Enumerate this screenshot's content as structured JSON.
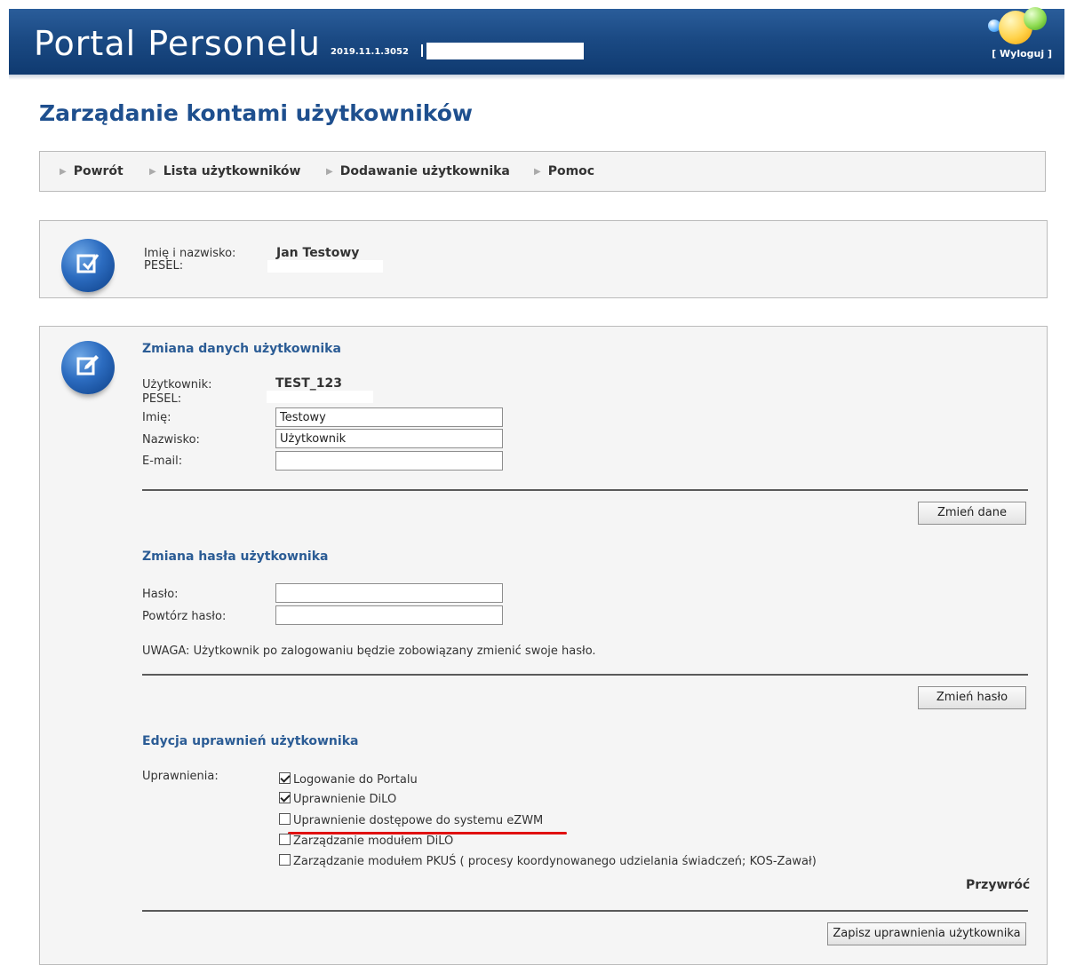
{
  "header": {
    "title": "Portal Personelu",
    "version": "2019.11.1.3052",
    "logout_label": "[ Wyloguj ]"
  },
  "page": {
    "title": "Zarządanie kontami użytkowników"
  },
  "nav": {
    "items": [
      {
        "label": "Powrót"
      },
      {
        "label": "Lista użytkowników"
      },
      {
        "label": "Dodawanie użytkownika"
      },
      {
        "label": "Pomoc"
      }
    ]
  },
  "summary": {
    "name_label": "Imię i nazwisko:",
    "name_value": "Jan Testowy",
    "pesel_label": "PESEL:"
  },
  "user_data": {
    "heading": "Zmiana danych użytkownika",
    "user_label": "Użytkownik:",
    "user_value": "TEST_123",
    "pesel_label": "PESEL:",
    "first_name_label": "Imię:",
    "first_name_value": "Testowy",
    "last_name_label": "Nazwisko:",
    "last_name_value": "Użytkownik",
    "email_label": "E-mail:",
    "email_value": "",
    "submit_label": "Zmień dane"
  },
  "password": {
    "heading": "Zmiana hasła użytkownika",
    "password_label": "Hasło:",
    "repeat_label": "Powtórz hasło:",
    "note": "UWAGA: Użytkownik po zalogowaniu będzie zobowiązany zmienić swoje hasło.",
    "submit_label": "Zmień hasło"
  },
  "permissions": {
    "heading": "Edycja uprawnień użytkownika",
    "label": "Uprawnienia:",
    "items": [
      {
        "label": "Logowanie do Portalu",
        "checked": true
      },
      {
        "label": "Uprawnienie DiLO",
        "checked": true
      },
      {
        "label": "Uprawnienie dostępowe do systemu eZWM",
        "checked": false
      },
      {
        "label": "Zarządzanie modułem DiLO",
        "checked": false
      },
      {
        "label": "Zarządzanie modułem PKUŚ ( procesy koordynowanego udzielania świadczeń; KOS-Zawał)",
        "checked": false
      }
    ],
    "restore_label": "Przywróć",
    "submit_label": "Zapisz uprawnienia użytkownika"
  },
  "colors": {
    "header_bg": "#1b4a84",
    "heading": "#1e4f8e",
    "section_heading": "#2b5c95",
    "highlight_underline": "#e01010"
  }
}
